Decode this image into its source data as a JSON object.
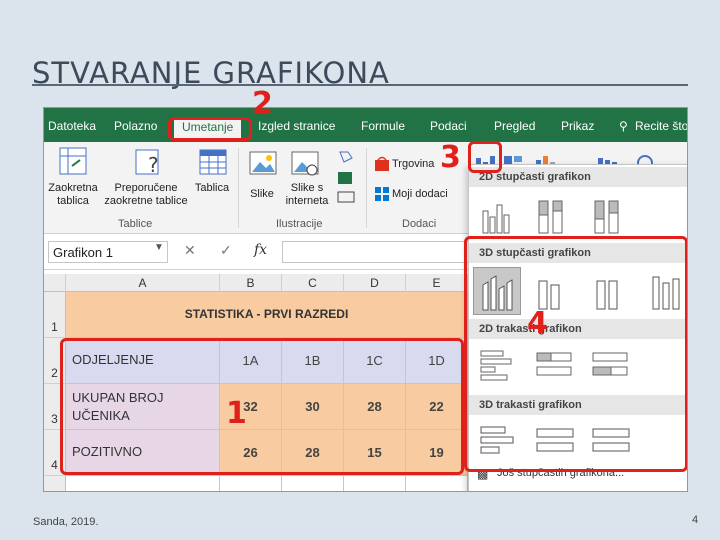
{
  "slide": {
    "title": "STVARANJE GRAFIKONA",
    "footer": "Sanda, 2019.",
    "page_number": "4"
  },
  "ribbon_tabs": [
    "Datoteka",
    "Polazno",
    "Umetanje",
    "Izgled stranice",
    "Formule",
    "Podaci",
    "Pregled",
    "Prikaz",
    "Recite što"
  ],
  "ribbon": {
    "pivot": "Zaokretna tablica",
    "recommended_pivot": "Preporučene zaokretne tablice",
    "table": "Tablica",
    "tables_group": "Tablice",
    "image": "Slike",
    "online_images": "Slike s interneta",
    "illustrations_group": "Ilustracije",
    "store": "Trgovina",
    "my_addins": "Moji dodaci",
    "addins_group": "Dodaci"
  },
  "formula_bar": {
    "name_box": "Grafikon 1",
    "fx": "fx"
  },
  "columns": [
    "A",
    "B",
    "C",
    "D",
    "E"
  ],
  "rows": [
    "1",
    "2",
    "3",
    "4"
  ],
  "table": {
    "title": "STATISTIKA - PRVI RAZREDI",
    "row2": {
      "label": "ODJELJENJE",
      "values": [
        "1A",
        "1B",
        "1C",
        "1D"
      ]
    },
    "row3": {
      "label": "UKUPAN BROJ UČENIKA",
      "values": [
        "32",
        "30",
        "28",
        "22"
      ]
    },
    "row4": {
      "label": "POZITIVNO",
      "values": [
        "26",
        "28",
        "15",
        "19"
      ]
    }
  },
  "dropdown": {
    "sec1": "2D stupčasti grafikon",
    "sec2": "3D stupčasti grafikon",
    "sec3": "2D trakasti grafikon",
    "sec4": "3D trakasti grafikon",
    "more": "Još stupčastih grafikona..."
  },
  "annotations": [
    "1",
    "2",
    "3",
    "4"
  ],
  "colors": {
    "accent_red": "#e0201b",
    "excel_green": "#217346"
  }
}
